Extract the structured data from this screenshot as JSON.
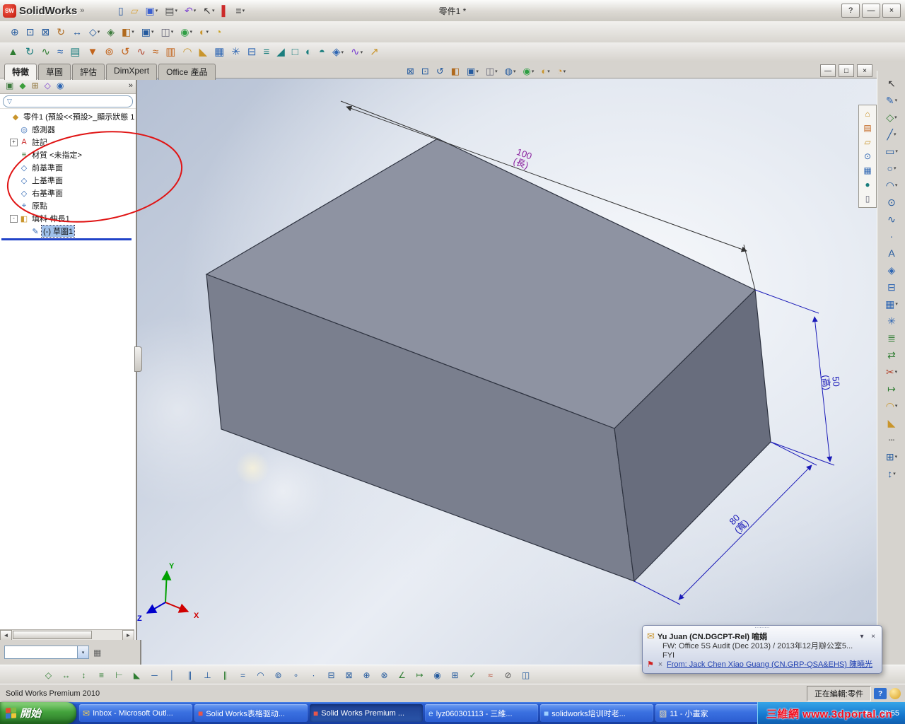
{
  "window": {
    "logo": "SolidWorks",
    "menu_arrow": "»",
    "title": "零件1 *",
    "help": "?",
    "minimize": "—",
    "close": "×"
  },
  "toolbar_standard": {
    "items": [
      {
        "name": "new-document-icon",
        "g": "▯",
        "c": "#2c5aa0"
      },
      {
        "name": "open-document-icon",
        "g": "▱",
        "c": "#d8a23a"
      },
      {
        "name": "save-icon",
        "g": "▣",
        "c": "#3a5fd0",
        "caret": "▾"
      },
      {
        "name": "print-icon",
        "g": "▤",
        "c": "#555555",
        "caret": "▾"
      },
      {
        "name": "undo-icon",
        "g": "↶",
        "c": "#7a3fd0",
        "caret": "▾"
      },
      {
        "name": "select-icon",
        "g": "↖",
        "c": "#333333",
        "caret": "▾"
      },
      {
        "name": "addins-icon",
        "g": "▌",
        "c": "#cc2a2a"
      },
      {
        "name": "options-icon",
        "g": "≡",
        "c": "#444444",
        "caret": "▾"
      }
    ]
  },
  "toolbar_view": {
    "items": [
      {
        "name": "zoom-in-out-icon",
        "g": "⊕",
        "c": "#245a9e"
      },
      {
        "name": "zoom-area-icon",
        "g": "⊡",
        "c": "#245a9e"
      },
      {
        "name": "zoom-fit-icon",
        "g": "⊠",
        "c": "#245a9e"
      },
      {
        "name": "rotate-view-icon",
        "g": "↻",
        "c": "#b06a1e"
      },
      {
        "name": "pan-icon",
        "g": "↔",
        "c": "#245a9e"
      },
      {
        "name": "standard-views-icon",
        "g": "◇",
        "c": "#245a9e",
        "caret": "▾"
      },
      {
        "name": "3d-drawing-view-icon",
        "g": "◈",
        "c": "#3b7a3b"
      },
      {
        "name": "section-view-icon",
        "g": "◧",
        "c": "#b06a1e",
        "caret": "▾"
      },
      {
        "name": "view-orientation-icon",
        "g": "▣",
        "c": "#245a9e",
        "caret": "▾"
      },
      {
        "name": "display-style-icon",
        "g": "◫",
        "c": "#666677",
        "caret": "▾"
      },
      {
        "name": "appearances-icon",
        "g": "◉",
        "c": "#2f9e44",
        "caret": "▾"
      },
      {
        "name": "scene-icon",
        "g": "◐",
        "c": "#c9952c",
        "caret": "▾"
      },
      {
        "name": "lights-icon",
        "g": "◔",
        "c": "#caa21f"
      }
    ]
  },
  "toolbar_features": {
    "items": [
      {
        "name": "extruded-boss-icon",
        "g": "▲",
        "c": "#2f7d32"
      },
      {
        "name": "revolved-boss-icon",
        "g": "↻",
        "c": "#1b7e7e"
      },
      {
        "name": "swept-boss-icon",
        "g": "∿",
        "c": "#2f7d32"
      },
      {
        "name": "lofted-boss-icon",
        "g": "≈",
        "c": "#2e66b3"
      },
      {
        "name": "boundary-boss-icon",
        "g": "▤",
        "c": "#1b7e7e"
      },
      {
        "name": "extruded-cut-icon",
        "g": "▼",
        "c": "#c2641c"
      },
      {
        "name": "hole-wizard-icon",
        "g": "⊚",
        "c": "#c2641c"
      },
      {
        "name": "revolved-cut-icon",
        "g": "↺",
        "c": "#c2641c"
      },
      {
        "name": "swept-cut-icon",
        "g": "∿",
        "c": "#b3452e"
      },
      {
        "name": "lofted-cut-icon",
        "g": "≈",
        "c": "#c2641c"
      },
      {
        "name": "boundary-cut-icon",
        "g": "▥",
        "c": "#c2641c"
      },
      {
        "name": "fillet-icon",
        "g": "◠",
        "c": "#c9952c"
      },
      {
        "name": "chamfer-icon",
        "g": "◣",
        "c": "#c9952c"
      },
      {
        "name": "linear-pattern-icon",
        "g": "▦",
        "c": "#2e66b3"
      },
      {
        "name": "circular-pattern-icon",
        "g": "✳",
        "c": "#2e66b3"
      },
      {
        "name": "mirror-icon",
        "g": "⊟",
        "c": "#2e66b3"
      },
      {
        "name": "rib-icon",
        "g": "≡",
        "c": "#1b7e7e"
      },
      {
        "name": "draft-icon",
        "g": "◢",
        "c": "#1b7e7e"
      },
      {
        "name": "shell-icon",
        "g": "□",
        "c": "#1b7e7e"
      },
      {
        "name": "wrap-icon",
        "g": "◐",
        "c": "#1b7e7e"
      },
      {
        "name": "dome-icon",
        "g": "◓",
        "c": "#1b7e7e"
      },
      {
        "name": "reference-geometry-icon",
        "g": "◈",
        "c": "#2e66b3",
        "caret": "▾"
      },
      {
        "name": "curves-icon",
        "g": "∿",
        "c": "#7a3fd0",
        "caret": "▾"
      },
      {
        "name": "instant3d-icon",
        "g": "↗",
        "c": "#c9952c"
      }
    ]
  },
  "tabs": {
    "items": [
      {
        "name": "tab-features",
        "label": "特徵",
        "active": "true"
      },
      {
        "name": "tab-sketch",
        "label": "草圖"
      },
      {
        "name": "tab-evaluate",
        "label": "評估"
      },
      {
        "name": "tab-dimxpert",
        "label": "DimXpert"
      },
      {
        "name": "tab-office-products",
        "label": "Office 產品"
      }
    ]
  },
  "headsup": {
    "items": [
      {
        "name": "zoom-fit-icon",
        "g": "⊠",
        "c": "#245a9e"
      },
      {
        "name": "zoom-area-icon",
        "g": "⊡",
        "c": "#245a9e"
      },
      {
        "name": "previous-view-icon",
        "g": "↺",
        "c": "#245a9e"
      },
      {
        "name": "section-view-icon",
        "g": "◧",
        "c": "#b06a1e"
      },
      {
        "name": "view-orientation-icon",
        "g": "▣",
        "c": "#245a9e",
        "caret": "▾"
      },
      {
        "name": "display-style-icon",
        "g": "◫",
        "c": "#666677",
        "caret": "▾"
      },
      {
        "name": "hide-show-items-icon",
        "g": "◍",
        "c": "#245a9e",
        "caret": "▾"
      },
      {
        "name": "edit-appearance-icon",
        "g": "◉",
        "c": "#2f9e44",
        "caret": "▾"
      },
      {
        "name": "apply-scene-icon",
        "g": "◐",
        "c": "#c9952c",
        "caret": "▾"
      },
      {
        "name": "view-settings-icon",
        "g": "◔",
        "c": "#d08a1f",
        "caret": "▾"
      }
    ]
  },
  "doc_controls": {
    "minimize": "—",
    "restore": "□",
    "close": "×"
  },
  "panel": {
    "manager_tabs": [
      {
        "name": "featuremanager-tab-icon",
        "g": "▣",
        "c": "#3b7a3b"
      },
      {
        "name": "propertymanager-tab-icon",
        "g": "◆",
        "c": "#3b9e3b"
      },
      {
        "name": "configurationmanager-tab-icon",
        "g": "⊞",
        "c": "#8a6d2f"
      },
      {
        "name": "dimxpertmanager-tab-icon",
        "g": "◇",
        "c": "#7a3fd0"
      },
      {
        "name": "displaymanager-tab-icon",
        "g": "◉",
        "c": "#2e66b3"
      }
    ],
    "chevron": "»",
    "filter_icon": "▽",
    "filter_placeholder": "",
    "tree": [
      {
        "name": "tree-item-part",
        "label": "零件1 (預設<<預設>_顯示狀態 1",
        "g": "◆",
        "c": "#c9952c",
        "ind": "0"
      },
      {
        "name": "tree-item-sensors",
        "label": "感測器",
        "g": "◎",
        "c": "#2e66b3",
        "ind": "1"
      },
      {
        "name": "tree-item-annotations",
        "label": "註記",
        "g": "A",
        "c": "#cc2a2a",
        "exp": "+",
        "ind": "1"
      },
      {
        "name": "tree-item-material",
        "label": "材質 <未指定>",
        "g": "≡",
        "c": "#3b7a3b",
        "ind": "1"
      },
      {
        "name": "tree-item-front-plane",
        "label": "前基準面",
        "g": "◇",
        "c": "#2e66b3",
        "ind": "1"
      },
      {
        "name": "tree-item-top-plane",
        "label": "上基準面",
        "g": "◇",
        "c": "#2e66b3",
        "ind": "1"
      },
      {
        "name": "tree-item-right-plane",
        "label": "右基準面",
        "g": "◇",
        "c": "#2e66b3",
        "ind": "1"
      },
      {
        "name": "tree-item-origin",
        "label": "原點",
        "g": "⌖",
        "c": "#2e66b3",
        "ind": "1"
      },
      {
        "name": "tree-item-boss-extrude1",
        "label": "填料-伸長1",
        "g": "◧",
        "c": "#c9952c",
        "exp": "-",
        "ind": "1"
      },
      {
        "name": "tree-item-sketch1",
        "label": "(-) 草圖1",
        "g": "✎",
        "c": "#2e66b3",
        "ind": "2",
        "sel": "true"
      }
    ]
  },
  "viewport": {
    "dims": {
      "length": {
        "value": "100",
        "label": "(長)"
      },
      "height": {
        "value": "50",
        "label": "(高)"
      },
      "width": {
        "value": "80",
        "label": "(寬)"
      }
    },
    "triad": {
      "x": "X",
      "y": "Y",
      "z": "Z"
    }
  },
  "task_pane": {
    "items": [
      {
        "name": "solidworks-resources-icon",
        "g": "⌂",
        "c": "#c9952c"
      },
      {
        "name": "design-library-icon",
        "g": "▤",
        "c": "#c2641c"
      },
      {
        "name": "file-explorer-icon",
        "g": "▱",
        "c": "#c9952c"
      },
      {
        "name": "search-icon",
        "g": "⊙",
        "c": "#2e66b3"
      },
      {
        "name": "view-palette-icon",
        "g": "▦",
        "c": "#2e66b3"
      },
      {
        "name": "appearances-scenes-icon",
        "g": "●",
        "c": "#1b7e7e"
      },
      {
        "name": "custom-properties-icon",
        "g": "▯",
        "c": "#666677"
      }
    ]
  },
  "toolbar_right": {
    "items": [
      {
        "name": "select-icon",
        "g": "↖",
        "c": "#333333"
      },
      {
        "name": "sketch-icon",
        "g": "✎",
        "c": "#2e66b3",
        "caret": "▾"
      },
      {
        "name": "smart-dimension-icon",
        "g": "◇",
        "c": "#2f7d32",
        "caret": "▾"
      },
      {
        "name": "line-icon",
        "g": "╱",
        "c": "#245a9e",
        "caret": "▾"
      },
      {
        "name": "rectangle-icon",
        "g": "▭",
        "c": "#245a9e",
        "caret": "▾"
      },
      {
        "name": "circle-icon",
        "g": "○",
        "c": "#245a9e",
        "caret": "▾"
      },
      {
        "name": "arc-icon",
        "g": "◠",
        "c": "#245a9e",
        "caret": "▾"
      },
      {
        "name": "ellipse-icon",
        "g": "⊙",
        "c": "#245a9e"
      },
      {
        "name": "spline-icon",
        "g": "∿",
        "c": "#245a9e"
      },
      {
        "name": "point-icon",
        "g": "∙",
        "c": "#245a9e"
      },
      {
        "name": "text-icon",
        "g": "A",
        "c": "#245a9e"
      },
      {
        "name": "plane-icon",
        "g": "◈",
        "c": "#2e66b3"
      },
      {
        "name": "mirror-entities-icon",
        "g": "⊟",
        "c": "#2e66b3"
      },
      {
        "name": "linear-sketch-pattern-icon",
        "g": "▦",
        "c": "#2e66b3",
        "caret": "▾"
      },
      {
        "name": "circular-sketch-pattern-icon",
        "g": "✳",
        "c": "#2e66b3"
      },
      {
        "name": "offset-entities-icon",
        "g": "≣",
        "c": "#2f7d32"
      },
      {
        "name": "convert-entities-icon",
        "g": "⇄",
        "c": "#2f7d32"
      },
      {
        "name": "trim-entities-icon",
        "g": "✂",
        "c": "#b3452e",
        "caret": "▾"
      },
      {
        "name": "extend-entities-icon",
        "g": "↦",
        "c": "#2f7d32"
      },
      {
        "name": "sketch-fillet-icon",
        "g": "◠",
        "c": "#c9952c",
        "caret": "▾"
      },
      {
        "name": "sketch-chamfer-icon",
        "g": "◣",
        "c": "#c9952c"
      },
      {
        "name": "construction-geometry-icon",
        "g": "┄",
        "c": "#555555"
      },
      {
        "name": "quick-snaps-icon",
        "g": "⊞",
        "c": "#245a9e",
        "caret": "▾"
      },
      {
        "name": "move-entities-icon",
        "g": "↕",
        "c": "#245a9e",
        "caret": "▾"
      }
    ]
  },
  "toolbar_relations": {
    "items": [
      {
        "name": "smart-dimension-icon",
        "g": "◇",
        "c": "#2f7d32"
      },
      {
        "name": "horizontal-dimension-icon",
        "g": "↔",
        "c": "#2f7d32"
      },
      {
        "name": "vertical-dimension-icon",
        "g": "↕",
        "c": "#2f7d32"
      },
      {
        "name": "baseline-dimension-icon",
        "g": "≡",
        "c": "#2f7d32"
      },
      {
        "name": "ordinate-dimension-icon",
        "g": "⊢",
        "c": "#2f7d32"
      },
      {
        "name": "chamfer-dimension-icon",
        "g": "◣",
        "c": "#2f7d32"
      },
      {
        "name": "horizontal-relation-icon",
        "g": "─",
        "c": "#245a9e"
      },
      {
        "name": "vertical-relation-icon",
        "g": "│",
        "c": "#245a9e"
      },
      {
        "name": "collinear-relation-icon",
        "g": "∥",
        "c": "#245a9e"
      },
      {
        "name": "perpendicular-relation-icon",
        "g": "⊥",
        "c": "#245a9e"
      },
      {
        "name": "parallel-relation-icon",
        "g": "∥",
        "c": "#2f7d32"
      },
      {
        "name": "equal-relation-icon",
        "g": "=",
        "c": "#245a9e"
      },
      {
        "name": "tangent-relation-icon",
        "g": "◠",
        "c": "#245a9e"
      },
      {
        "name": "concentric-relation-icon",
        "g": "⊚",
        "c": "#245a9e"
      },
      {
        "name": "coincident-relation-icon",
        "g": "∘",
        "c": "#245a9e"
      },
      {
        "name": "midpoint-relation-icon",
        "g": "∙",
        "c": "#245a9e"
      },
      {
        "name": "symmetric-relation-icon",
        "g": "⊟",
        "c": "#245a9e"
      },
      {
        "name": "fix-relation-icon",
        "g": "⊠",
        "c": "#245a9e"
      },
      {
        "name": "merge-points-icon",
        "g": "⊕",
        "c": "#245a9e"
      },
      {
        "name": "intersection-icon",
        "g": "⊗",
        "c": "#245a9e"
      },
      {
        "name": "angle-dimension-icon",
        "g": "∠",
        "c": "#2f7d32"
      },
      {
        "name": "distance-dimension-icon",
        "g": "↦",
        "c": "#2f7d32"
      },
      {
        "name": "display-relations-icon",
        "g": "◉",
        "c": "#245a9e"
      },
      {
        "name": "add-relation-icon",
        "g": "⊞",
        "c": "#245a9e"
      },
      {
        "name": "fully-define-sketch-icon",
        "g": "✓",
        "c": "#2f7d32"
      },
      {
        "name": "repair-sketch-icon",
        "g": "≈",
        "c": "#b3452e"
      },
      {
        "name": "no-solve-move-icon",
        "g": "⊘",
        "c": "#555555"
      },
      {
        "name": "dynamic-mirror-icon",
        "g": "◫",
        "c": "#245a9e"
      }
    ]
  },
  "notification": {
    "grip": "⋯⋯⋯",
    "mail_icon": "✉",
    "title": "Yu Juan (CN.DGCPT-Rel) 喻娟",
    "chevron": "▾",
    "close": "×",
    "line1": "FW: Office 5S Audit (Dec  2013) / 2013年12月辦公室5...",
    "line2": "FYI",
    "flag": "⚑",
    "delete": "×",
    "from": "From: Jack Chen Xiao Guang (CN.GRP-QSA&EHS) 陳曉光"
  },
  "statusbar": {
    "left": "Solid Works Premium 2010",
    "editing": "正在編輯:零件",
    "help": "?"
  },
  "taskbar": {
    "start": "開始",
    "items": [
      {
        "name": "taskbar-item-outlook-inbox",
        "label": "Inbox - Microsoft Outl...",
        "g": "✉",
        "c": "#f3cf55"
      },
      {
        "name": "taskbar-item-sw-table",
        "label": "Solid Works表格驱动...",
        "g": "■",
        "c": "#e8564a"
      },
      {
        "name": "taskbar-item-sw-premium",
        "label": "Solid Works Premium ...",
        "g": "■",
        "c": "#e8564a",
        "active": "true"
      },
      {
        "name": "taskbar-item-3d-doc",
        "label": "lyz060301113 - 三維...",
        "g": "e",
        "c": "#bfe0ff"
      },
      {
        "name": "taskbar-item-sw-training",
        "label": "solidworks培训时老...",
        "g": "■",
        "c": "#9fd0ff"
      },
      {
        "name": "taskbar-item-paint",
        "label": "11 - 小畫家",
        "g": "▨",
        "c": "#f0e0b0"
      }
    ],
    "tray": [
      {
        "name": "tray-outlook-icon",
        "g": "✉",
        "c": "#ffe9a8"
      },
      {
        "name": "tray-volume-icon",
        "g": "◄",
        "c": "#e8f4ff"
      },
      {
        "name": "tray-network-icon",
        "g": "▮",
        "c": "#cfe8ff"
      }
    ],
    "clock": "08:55"
  },
  "watermark": "三維網 www.3dportal.cn",
  "combo": {
    "value": "",
    "caret": "▾",
    "icon": "▦"
  }
}
